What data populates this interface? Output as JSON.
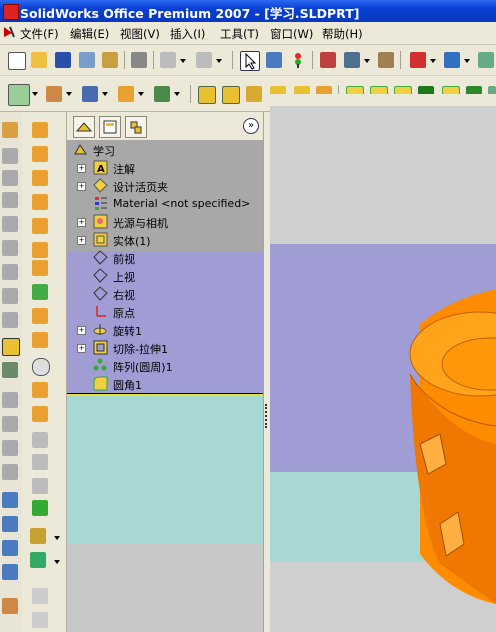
{
  "window": {
    "title": "SolidWorks Office Premium 2007 - [学习.SLDPRT]"
  },
  "menu": [
    {
      "label": "文件(F)"
    },
    {
      "label": "编辑(E)"
    },
    {
      "label": "视图(V)"
    },
    {
      "label": "插入(I)"
    },
    {
      "label": "工具(T)"
    },
    {
      "label": "窗口(W)"
    },
    {
      "label": "帮助(H)"
    }
  ],
  "tree": {
    "root": "学习",
    "nodes": [
      {
        "label": "注解",
        "expandable": true,
        "icon": "annotations-icon"
      },
      {
        "label": "设计活页夹",
        "expandable": true,
        "icon": "design-binder-icon"
      },
      {
        "label": "Material <not specified>",
        "expandable": false,
        "icon": "material-icon"
      },
      {
        "label": "光源与相机",
        "expandable": true,
        "icon": "lights-cameras-icon"
      },
      {
        "label": "实体(1)",
        "expandable": true,
        "icon": "solid-bodies-icon"
      },
      {
        "label": "前视",
        "expandable": false,
        "icon": "plane-icon"
      },
      {
        "label": "上视",
        "expandable": false,
        "icon": "plane-icon"
      },
      {
        "label": "右视",
        "expandable": false,
        "icon": "plane-icon"
      },
      {
        "label": "原点",
        "expandable": false,
        "icon": "origin-icon"
      },
      {
        "label": "旋转1",
        "expandable": true,
        "icon": "revolve-icon"
      },
      {
        "label": "切除-拉伸1",
        "expandable": true,
        "icon": "cut-extrude-icon"
      },
      {
        "label": "阵列(圆周)1",
        "expandable": false,
        "icon": "circular-pattern-icon"
      },
      {
        "label": "圆角1",
        "expandable": false,
        "icon": "fillet-icon"
      }
    ]
  },
  "colors": {
    "part_orange": "#ff8c00",
    "viewport_gray": "#cfcfcf",
    "viewport_lavender": "#a09cd4",
    "viewport_teal": "#a8d8d4",
    "tree_gray": "#a8a8a8",
    "tree_lavender": "#a09cd4",
    "tree_teal": "#a8d8d4"
  }
}
